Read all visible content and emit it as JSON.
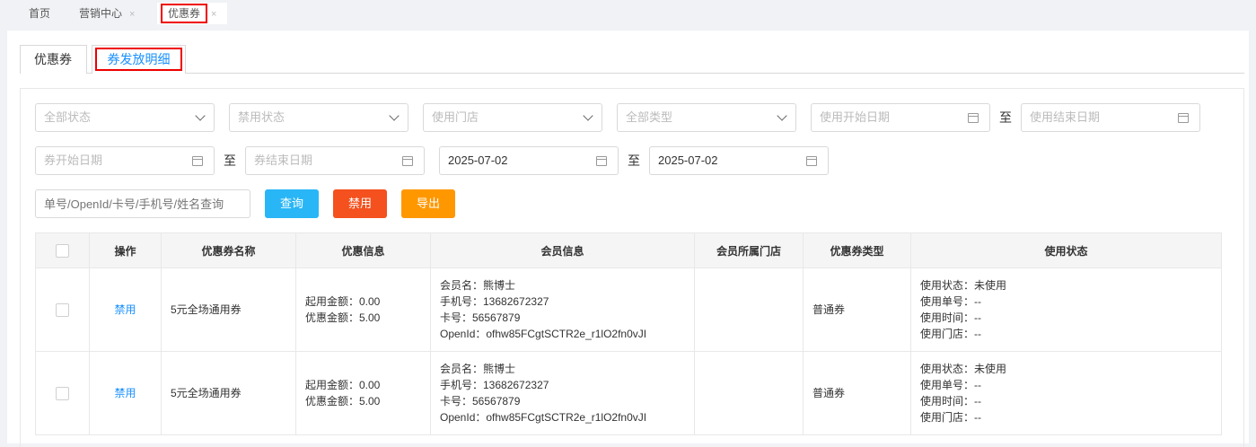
{
  "top_tabs": {
    "home": "首页",
    "marketing": "营销中心",
    "coupon": "优惠券",
    "close": "×"
  },
  "sub_tabs": {
    "coupon": "优惠券",
    "detail": "券发放明细"
  },
  "filters": {
    "status": "全部状态",
    "ban_status": "禁用状态",
    "store": "使用门店",
    "type": "全部类型",
    "use_start": "使用开始日期",
    "use_end": "使用结束日期",
    "coupon_start": "券开始日期",
    "coupon_end": "券结束日期",
    "issue_start": "2025-07-02",
    "issue_end": "2025-07-02",
    "to": "至",
    "search_placeholder": "单号/OpenId/卡号/手机号/姓名查询"
  },
  "buttons": {
    "query": "查询",
    "ban": "禁用",
    "export": "导出"
  },
  "table": {
    "headers": [
      "",
      "操作",
      "优惠券名称",
      "优惠信息",
      "会员信息",
      "会员所属门店",
      "优惠券类型",
      "使用状态"
    ],
    "rows": [
      {
        "action": "禁用",
        "name": "5元全场通用券",
        "discount": [
          "起用金额：0.00",
          "优惠金额：5.00"
        ],
        "member": [
          "会员名：熊博士",
          "手机号：13682672327",
          "卡号：56567879",
          "OpenId：ofhw85FCgtSCTR2e_r1lO2fn0vJI"
        ],
        "store": "",
        "type": "普通券",
        "usage": [
          "使用状态：未使用",
          "使用单号：--",
          "使用时间：--",
          "使用门店：--"
        ]
      },
      {
        "action": "禁用",
        "name": "5元全场通用券",
        "discount": [
          "起用金额：0.00",
          "优惠金额：5.00"
        ],
        "member": [
          "会员名：熊博士",
          "手机号：13682672327",
          "卡号：56567879",
          "OpenId：ofhw85FCgtSCTR2e_r1lO2fn0vJI"
        ],
        "store": "",
        "type": "普通券",
        "usage": [
          "使用状态：未使用",
          "使用单号：--",
          "使用时间：--",
          "使用门店：--"
        ]
      }
    ]
  },
  "colors": {
    "primary": "#1890ff",
    "query": "#29b6f6",
    "ban": "#f4511e",
    "export": "#ff9800",
    "highlight": "#e00000"
  }
}
